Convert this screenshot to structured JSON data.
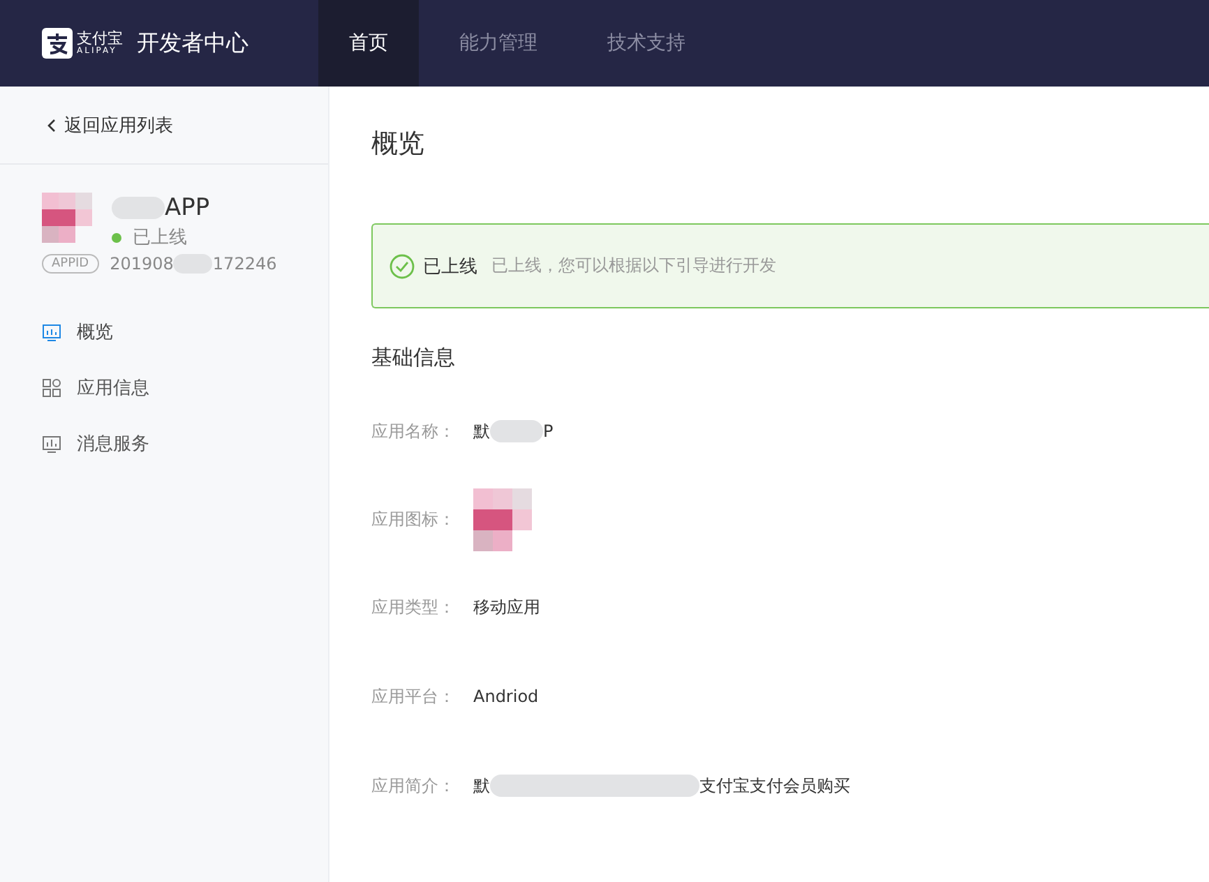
{
  "header": {
    "brand_cn": "支付宝",
    "brand_en": "ALIPAY",
    "title": "开发者中心",
    "tabs": [
      {
        "label": "首页",
        "selected": true
      },
      {
        "label": "能力管理",
        "selected": false
      },
      {
        "label": "技术支持",
        "selected": false
      }
    ]
  },
  "sidebar": {
    "back": "返回应用列表",
    "app": {
      "name_parts": [
        "APP"
      ],
      "status": "已上线",
      "online": true,
      "appid_badge": "APPID",
      "appid_parts": [
        "201908",
        "172246"
      ]
    },
    "items": [
      {
        "label": "概览",
        "selected": true
      },
      {
        "label": "应用信息",
        "selected": false
      },
      {
        "label": "消息服务",
        "selected": false
      }
    ]
  },
  "main": {
    "title": "概览",
    "alert": {
      "kind": "success",
      "title": "已上线",
      "message": "已上线，您可以根据以下引导进行开发"
    },
    "section": "基础信息",
    "fields": [
      {
        "label": "应用名称：",
        "kind": "redacted",
        "parts": [
          "默",
          "P"
        ]
      },
      {
        "label": "应用图标：",
        "kind": "picture"
      },
      {
        "label": "应用类型：",
        "kind": "text",
        "value": "移动应用"
      },
      {
        "label": "应用平台：",
        "kind": "text",
        "value": "Andriod"
      },
      {
        "label": "应用简介：",
        "kind": "redacted",
        "parts": [
          "默",
          "支付宝支付会员购买"
        ]
      }
    ]
  }
}
